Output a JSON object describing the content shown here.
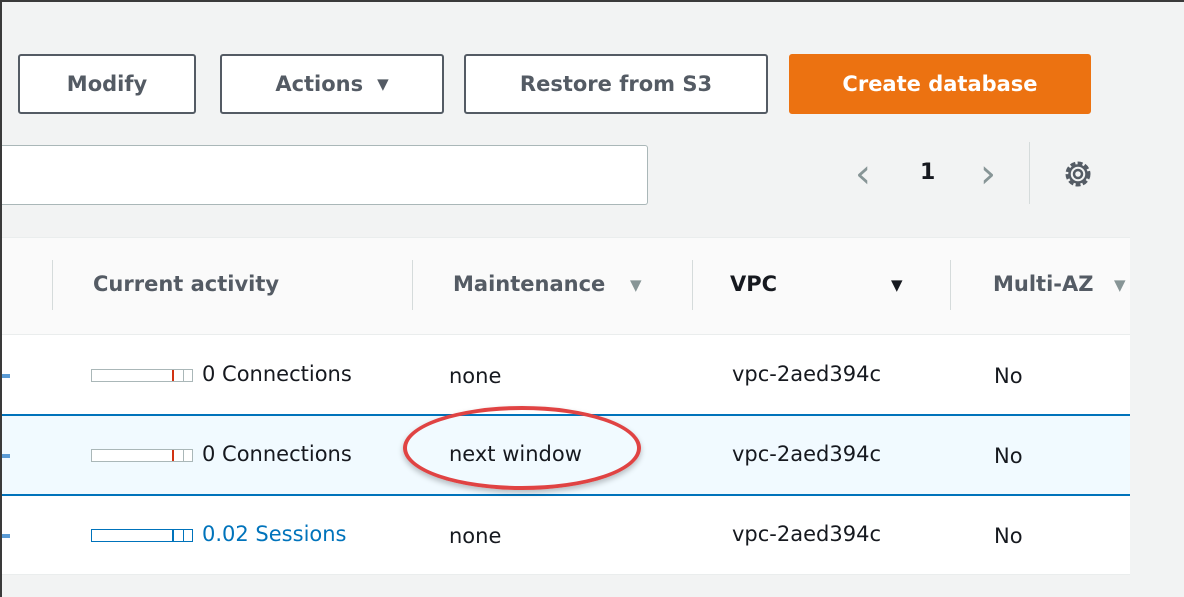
{
  "toolbar": {
    "modify_label": "Modify",
    "actions_label": "Actions",
    "actions_caret": "▼",
    "restore_label": "Restore from S3",
    "create_label": "Create database"
  },
  "search": {
    "value": "",
    "placeholder": ""
  },
  "pagination": {
    "prev": "‹",
    "current_page": "1",
    "next": "›"
  },
  "table": {
    "columns": [
      {
        "label": "Current activity",
        "sort_icon": ""
      },
      {
        "label": "Maintenance",
        "sort_icon": "▼"
      },
      {
        "label": "VPC",
        "sort_icon": "▼"
      },
      {
        "label": "Multi-AZ",
        "sort_icon": "▼"
      }
    ],
    "rows": [
      {
        "activity": "0 Connections",
        "maintenance": "none",
        "vpc": "vpc-2aed394c",
        "multi_az": "No"
      },
      {
        "activity": "0 Connections",
        "maintenance": "next window",
        "vpc": "vpc-2aed394c",
        "multi_az": "No"
      },
      {
        "activity": "0.02 Sessions",
        "maintenance": "none",
        "vpc": "vpc-2aed394c",
        "multi_az": "No"
      }
    ]
  },
  "colors": {
    "primary": "#ec7211",
    "link": "#0073bb",
    "selection_border": "#0073bb",
    "highlight": "#e04343"
  }
}
